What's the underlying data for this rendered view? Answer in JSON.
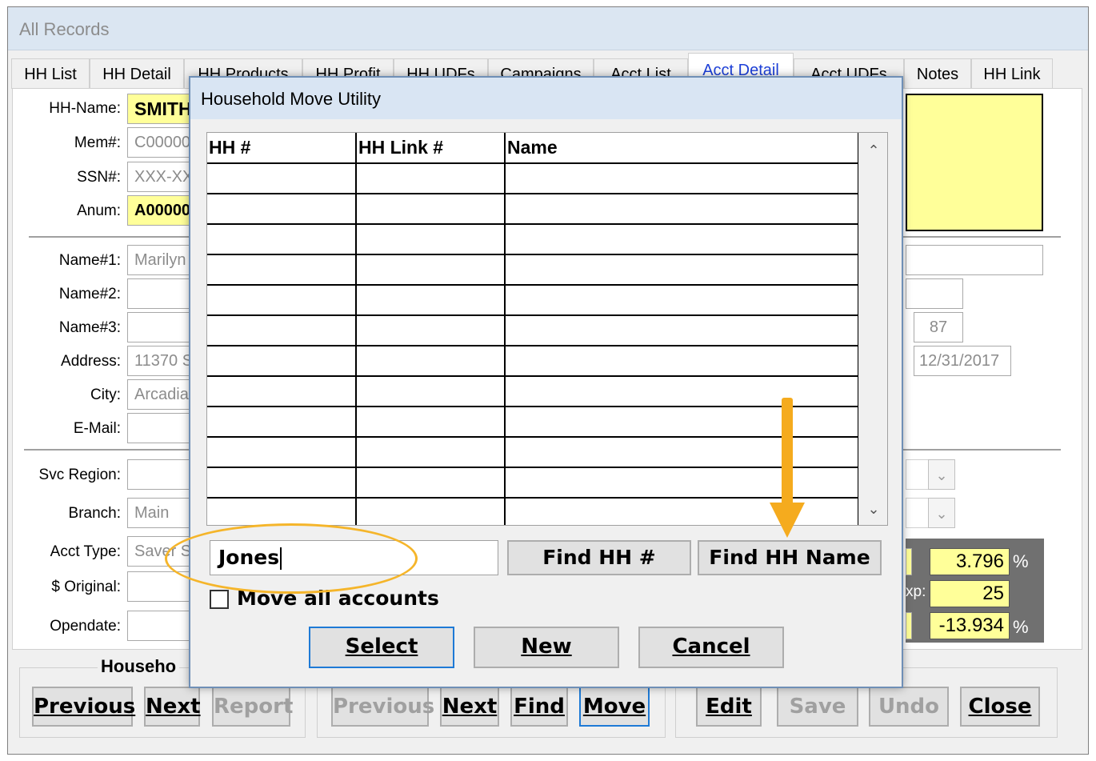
{
  "window": {
    "title": "All Records"
  },
  "tabs": [
    "HH List",
    "HH Detail",
    "HH Products",
    "HH Profit",
    "HH UDFs",
    "Campaigns",
    "Acct List",
    "Acct Detail",
    "Acct UDFs",
    "Notes",
    "HH Link"
  ],
  "active_tab": "Acct Detail",
  "form": {
    "hh_name_label": "HH-Name:",
    "hh_name_value": "SMITH",
    "mem_label": "Mem#:",
    "mem_value": "C00000",
    "ssn_label": "SSN#:",
    "ssn_value": "XXX-XX",
    "anum_label": "Anum:",
    "anum_value": "A00000",
    "name1_label": "Name#1:",
    "name1_value": "Marilyn",
    "name2_label": "Name#2:",
    "name3_label": "Name#3:",
    "address_label": "Address:",
    "address_value": "11370 S",
    "city_label": "City:",
    "city_value": "Arcadia",
    "email_label": "E-Mail:",
    "svc_region_label": "Svc Region:",
    "branch_label": "Branch:",
    "branch_value": "Main",
    "acct_type_label": "Acct Type:",
    "acct_type_value": "Saver S",
    "original_label": "$ Original:",
    "opendate_label": "Opendate:",
    "right_num": "87",
    "right_date": "12/31/2017",
    "rate1": "3.796",
    "rate2": "25",
    "rate3": "-13.934",
    "pct": "%",
    "exp_label": "xp:"
  },
  "groups": {
    "household_label": "Househo"
  },
  "bottom_buttons": {
    "previous1": "Previous",
    "next1": "Next",
    "report": "Report",
    "previous2": "Previous",
    "next2": "Next",
    "find": "Find",
    "move": "Move",
    "edit": "Edit",
    "save": "Save",
    "undo": "Undo",
    "close": "Close"
  },
  "dialog": {
    "title": "Household Move Utility",
    "columns": [
      "HH #",
      "HH Link #",
      "Name"
    ],
    "search_value": "Jones",
    "find_hh_num": "Find HH #",
    "find_hh_name": "Find HH Name",
    "move_all_label": "Move all accounts",
    "move_all_checked": false,
    "select": "Select",
    "new": "New",
    "cancel": "Cancel"
  },
  "colors": {
    "highlight": "#ffff99",
    "annotation": "#f5ab1e",
    "active_tab": "#1c3fd8"
  }
}
